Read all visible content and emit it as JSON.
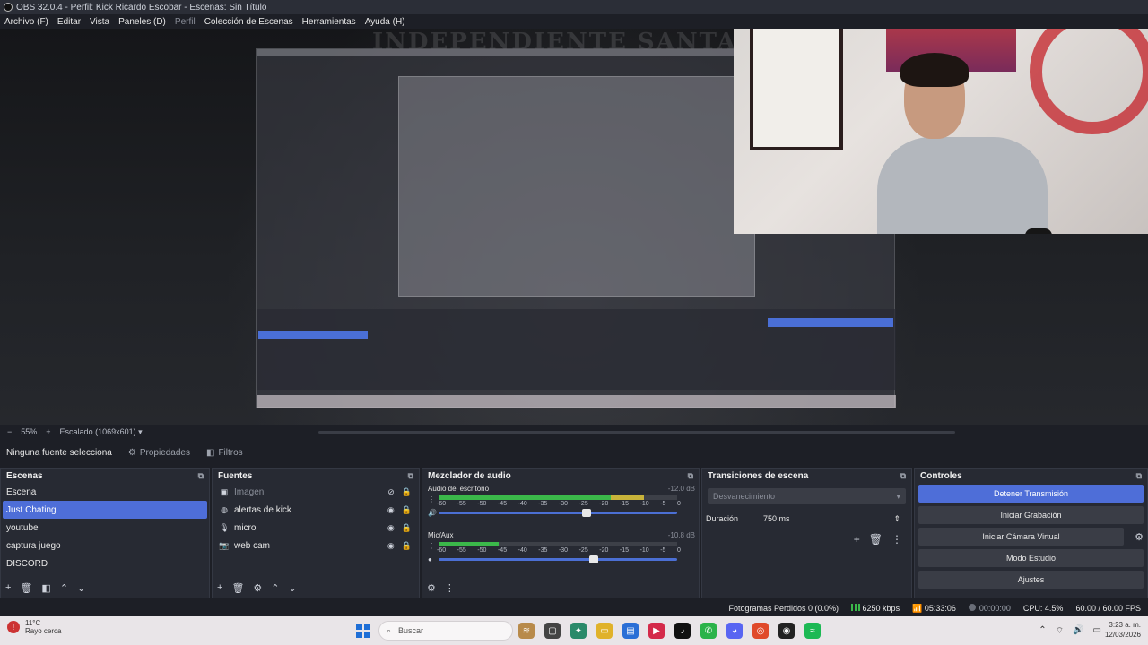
{
  "window": {
    "title": "OBS 32.0.4 - Perfil: Kick Ricardo Escobar - Escenas: Sin Título"
  },
  "menu": [
    "Archivo (F)",
    "Editar",
    "Vista",
    "Paneles (D)",
    "Perfil",
    "Colección de Escenas",
    "Herramientas",
    "Ayuda (H)"
  ],
  "preview": {
    "banner_text": "INDEPENDIENTE SANTA FE",
    "zoom": "55%",
    "scale": "Escalado (1069x601)"
  },
  "source_toolbar": {
    "no_source": "Ninguna fuente selecciona",
    "properties": "Propiedades",
    "filters": "Filtros"
  },
  "scenes": {
    "title": "Escenas",
    "items": [
      "Escena",
      "Just Chating",
      "youtube",
      "captura juego",
      "DISCORD"
    ],
    "selected": "Just Chating"
  },
  "sources": {
    "title": "Fuentes",
    "items": [
      {
        "name": "Imagen",
        "icon": "image-icon",
        "visible": false
      },
      {
        "name": "alertas de kick",
        "icon": "browser-icon",
        "visible": true
      },
      {
        "name": "micro",
        "icon": "microphone-icon",
        "visible": true
      },
      {
        "name": "web cam",
        "icon": "camera-icon",
        "visible": true
      }
    ]
  },
  "mixer": {
    "title": "Mezclador de audio",
    "channels": [
      {
        "name": "Audio del escritorio",
        "db": "-12.0 dB",
        "level": 0.86,
        "volume": 0.62
      },
      {
        "name": "Mic/Aux",
        "db": "-10.8 dB",
        "level": 0.25,
        "volume": 0.65
      }
    ],
    "ticks": [
      "-60",
      "-55",
      "-50",
      "-45",
      "-40",
      "-35",
      "-30",
      "-25",
      "-20",
      "-15",
      "-10",
      "-5",
      "0"
    ]
  },
  "transitions": {
    "title": "Transiciones de escena",
    "selected": "Desvanecimiento",
    "duration_label": "Duración",
    "duration_value": "750 ms"
  },
  "controls": {
    "title": "Controles",
    "buttons": [
      "Detener Transmisión",
      "Iniciar Grabación",
      "Iniciar Cámara Virtual",
      "Modo Estudio",
      "Ajustes"
    ]
  },
  "status": {
    "dropped": "Fotogramas Perdidos 0 (0.0%)",
    "bitrate": "6250 kbps",
    "stream_time": "05:33:06",
    "rec_time": "00:00:00",
    "cpu": "CPU: 4.5%",
    "fps": "60.00 / 60.00 FPS"
  },
  "taskbar": {
    "temp": "11°C",
    "weather": "Rayo cerca",
    "search_placeholder": "Buscar",
    "time": "3:23 a. m.",
    "date": "12/03/2026"
  },
  "colors": {
    "accent": "#4e6ed8",
    "panel": "#272a33",
    "bg": "#1d1f26"
  }
}
